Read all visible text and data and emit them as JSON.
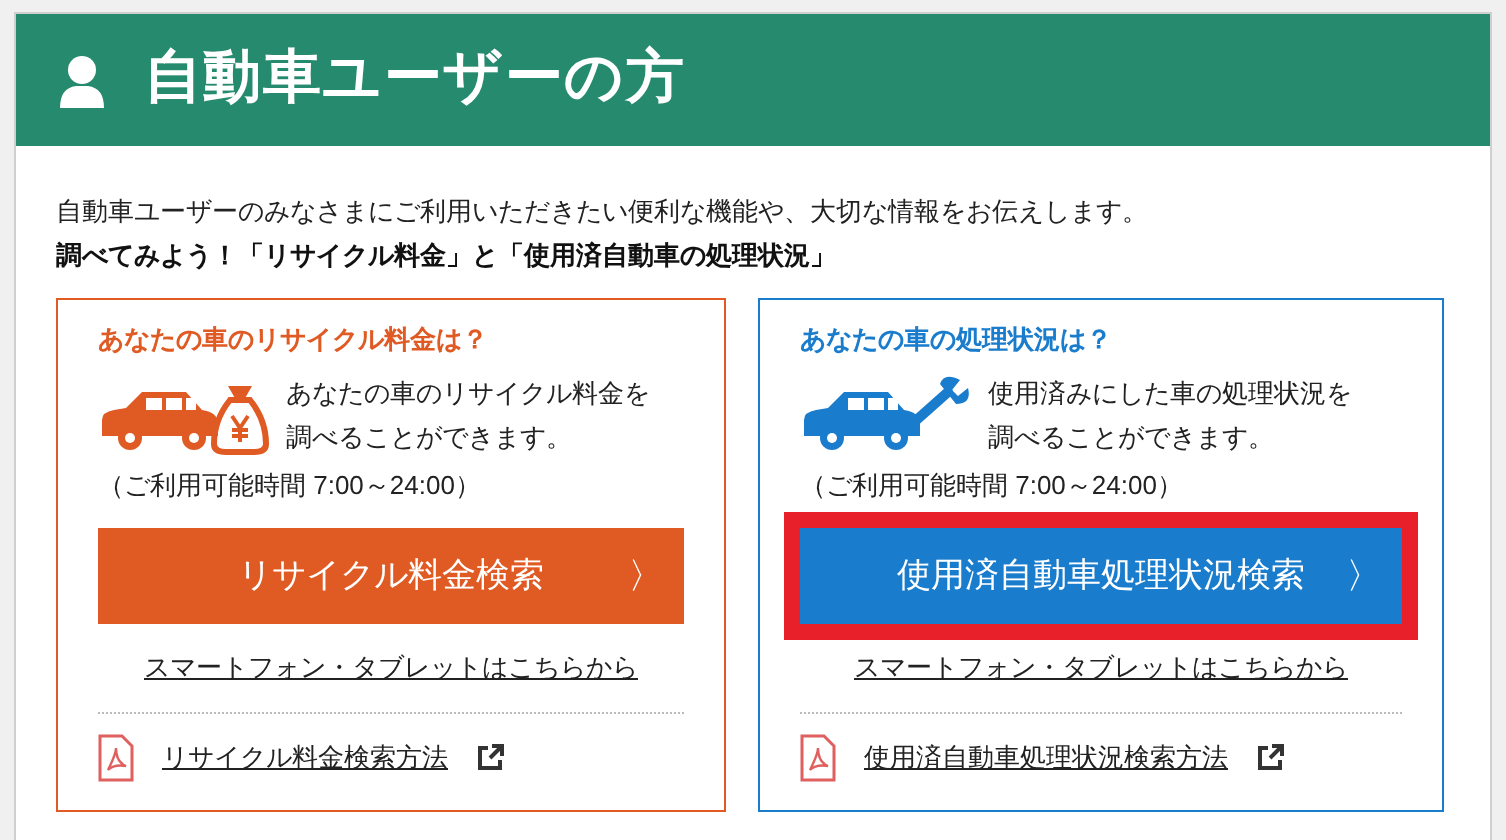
{
  "header": {
    "title": "自動車ユーザーの方"
  },
  "intro": {
    "text": "自動車ユーザーのみなさまにご利用いただきたい便利な機能や、大切な情報をお伝えします。",
    "lead": "調べてみよう！「リサイクル料金」と「使用済自動車の処理状況」"
  },
  "cards": [
    {
      "kind": "fee",
      "color": "#e05a24",
      "title": "あなたの車のリサイクル料金は？",
      "description_lines": [
        "あなたの車のリサイクル料金を",
        "調べることができます。"
      ],
      "hours": "（ご利用可能時間 7:00～24:00）",
      "button": {
        "label": "リサイクル料金検索",
        "arrow": "〉",
        "highlighted": false
      },
      "mobile_link": "スマートフォン・タブレットはこちらから",
      "manual_link": "リサイクル料金検索方法"
    },
    {
      "kind": "status",
      "color": "#1a7ccc",
      "title": "あなたの車の処理状況は？",
      "description_lines": [
        "使用済みにした車の処理状況を",
        "調べることができます。"
      ],
      "hours": "（ご利用可能時間 7:00～24:00）",
      "button": {
        "label": "使用済自動車処理状況検索",
        "arrow": "〉",
        "highlighted": true
      },
      "mobile_link": "スマートフォン・タブレットはこちらから",
      "manual_link": "使用済自動車処理状況検索方法"
    }
  ]
}
